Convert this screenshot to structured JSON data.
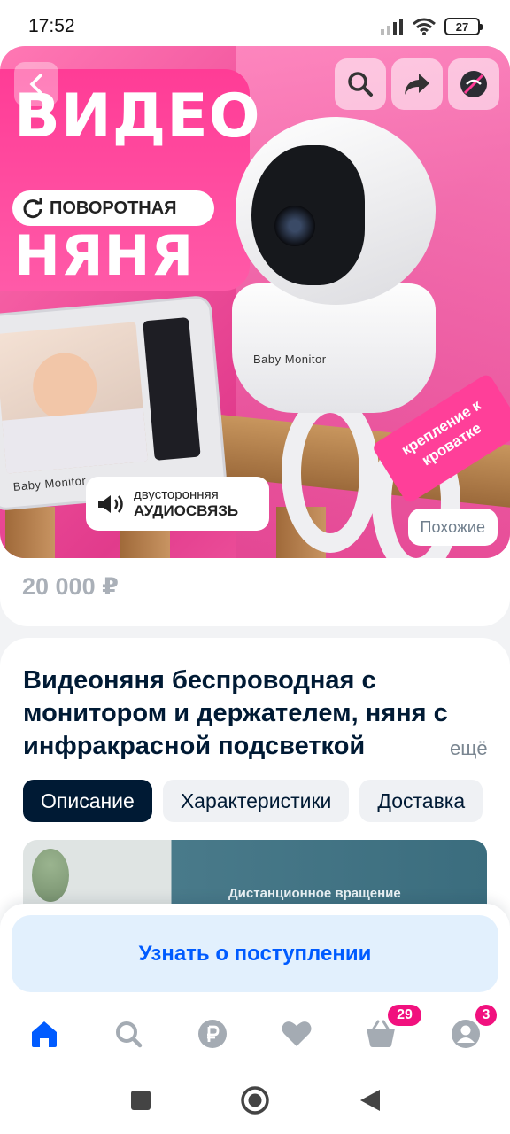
{
  "status_bar": {
    "time": "17:52",
    "battery": "27",
    "icons": [
      "signal-icon",
      "wifi-icon",
      "battery-icon"
    ]
  },
  "hero": {
    "line1": "ВИДЕО",
    "pill": "ПОВОРОТНАЯ",
    "line2": "НЯНЯ",
    "monitor_label": "Baby Monitor",
    "camera_label": "Baby Monitor",
    "ribbon": "крепление к кроватке",
    "audio_line1": "двусторонняя",
    "audio_line2": "АУДИОСВЯЗЬ",
    "similar_button": "Похожие"
  },
  "product": {
    "price": "20 000 ₽",
    "title": "Видеоняня беспроводная с монитором и держателем, няня с инфракрасной подсветкой",
    "more": "ещё"
  },
  "tabs": [
    {
      "label": "Описание",
      "active": true
    },
    {
      "label": "Характеристики",
      "active": false
    },
    {
      "label": "Доставка",
      "active": false
    }
  ],
  "description": {
    "image_caption": "Дистанционное вращение"
  },
  "notify_button": "Узнать о поступлении",
  "bottom_nav": {
    "items": [
      "home-icon",
      "search-icon",
      "ruble-icon",
      "heart-icon",
      "cart-icon",
      "profile-icon"
    ],
    "cart_badge": "29",
    "profile_badge": "3"
  },
  "colors": {
    "accent": "#005bff",
    "badge": "#f1117e",
    "hero_pink": "#ff3c96",
    "text": "#001a34"
  }
}
